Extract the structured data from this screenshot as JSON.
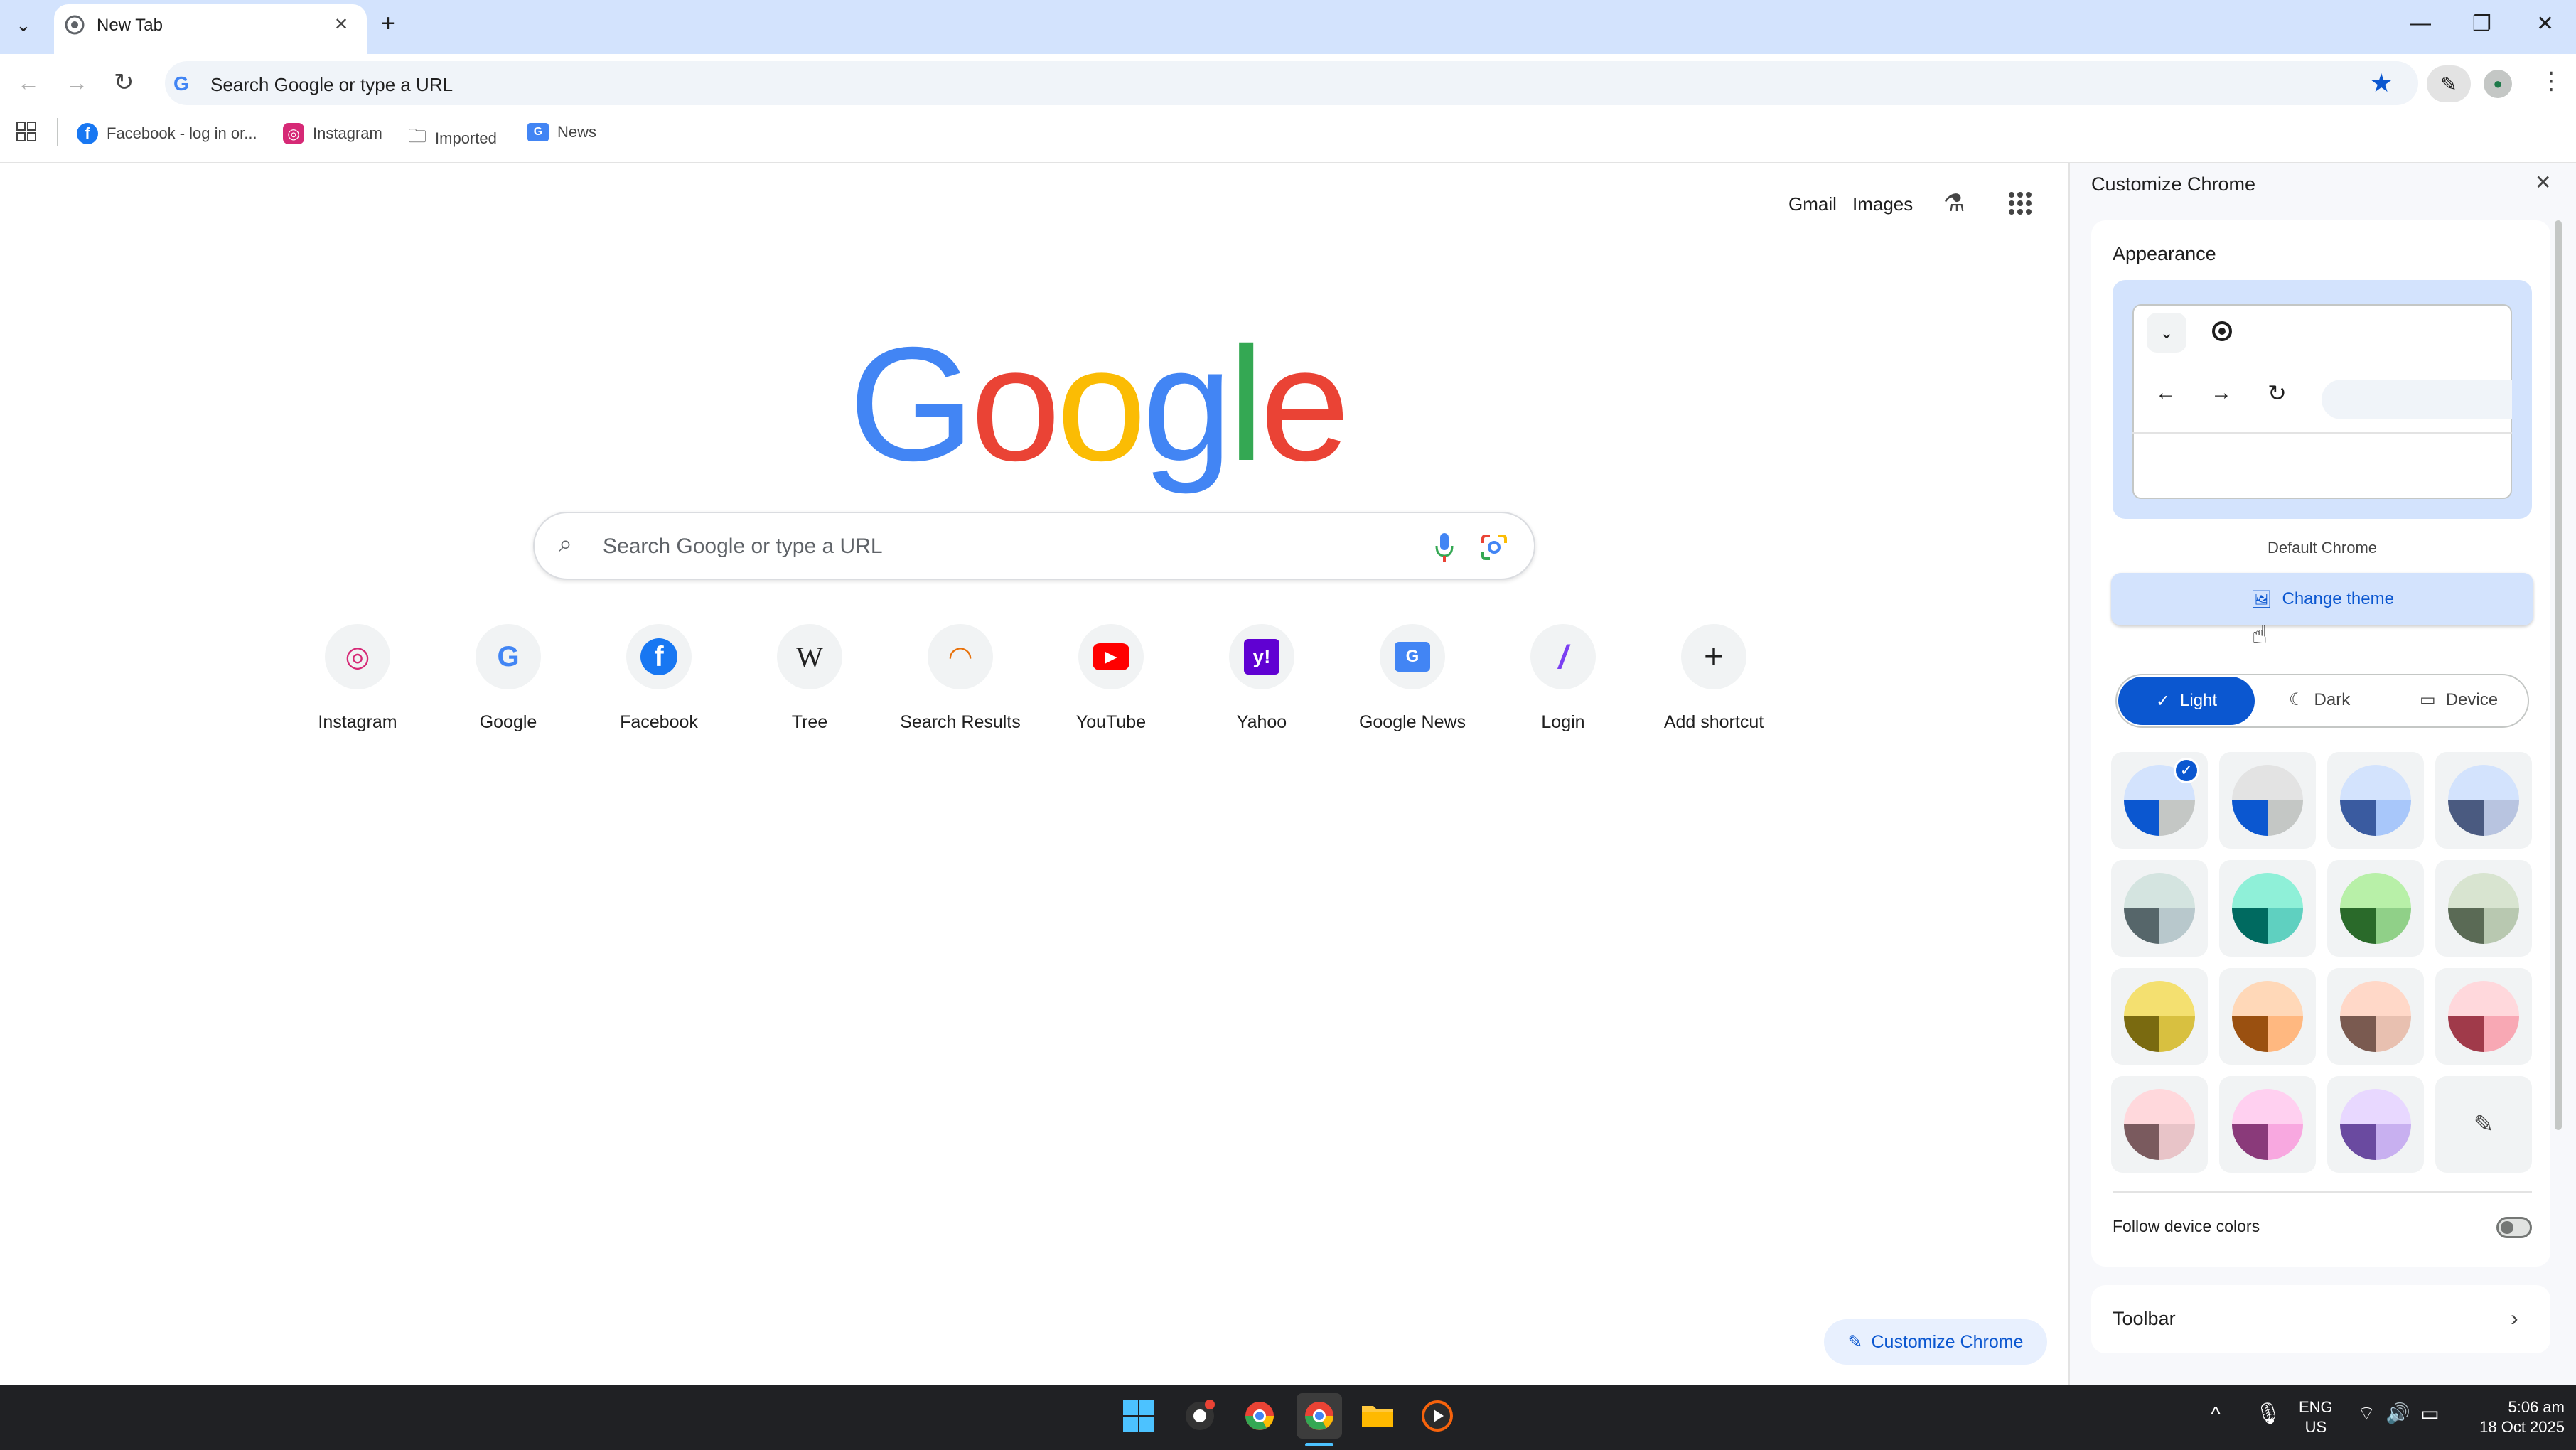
{
  "tab": {
    "title": "New Tab",
    "close": "✕",
    "new": "+"
  },
  "window_controls": {
    "minimize": "—",
    "restore": "❐",
    "close": "✕"
  },
  "omnibox": {
    "text": "Search Google or type a URL"
  },
  "bookmarks": [
    {
      "label": "Facebook - log in or...",
      "icon": "facebook-icon"
    },
    {
      "label": "Instagram",
      "icon": "instagram-icon"
    },
    {
      "label": "Imported",
      "icon": "folder-icon"
    },
    {
      "label": "News",
      "icon": "news-icon"
    }
  ],
  "ntp": {
    "links": {
      "gmail": "Gmail",
      "images": "Images"
    },
    "logo": "Google",
    "search_placeholder": "Search Google or type a URL",
    "shortcuts": [
      {
        "label": "Instagram",
        "glyph": "◎",
        "color": "#d62976"
      },
      {
        "label": "Google",
        "glyph": "G",
        "color": "#4285f4"
      },
      {
        "label": "Facebook",
        "glyph": "f",
        "color": "#1877f2"
      },
      {
        "label": "Tree",
        "glyph": "W",
        "color": "#222222"
      },
      {
        "label": "Search Results",
        "glyph": "◠",
        "color": "#e8710a"
      },
      {
        "label": "YouTube",
        "glyph": "▶",
        "color": "#ff0000"
      },
      {
        "label": "Yahoo",
        "glyph": "y!",
        "color": "#6001d2"
      },
      {
        "label": "Google News",
        "glyph": "G",
        "color": "#4285f4"
      },
      {
        "label": "Login",
        "glyph": "/",
        "color": "#7b3ff2"
      },
      {
        "label": "Add shortcut",
        "glyph": "+",
        "color": "#1f1f1f"
      }
    ],
    "customize_button": "Customize Chrome"
  },
  "panel": {
    "title": "Customize Chrome",
    "appearance": "Appearance",
    "default_label": "Default Chrome",
    "change_theme": "Change theme",
    "modes": {
      "light": "Light",
      "dark": "Dark",
      "device": "Device"
    },
    "swatches": [
      {
        "top": "#d3e3fd",
        "left": "#0b57d0",
        "right": "#c4c7c5",
        "selected": true
      },
      {
        "top": "#e3e3e3",
        "left": "#0b57d0",
        "right": "#c4c7c5"
      },
      {
        "top": "#d3e3fd",
        "left": "#3a5ba0",
        "right": "#a8c7fa"
      },
      {
        "top": "#d3e3fd",
        "left": "#4a5a80",
        "right": "#b8c4e0"
      },
      {
        "top": "#d4e4e0",
        "left": "#56666a",
        "right": "#b8c8cc"
      },
      {
        "top": "#8ff0d8",
        "left": "#006a60",
        "right": "#5fd0c0"
      },
      {
        "top": "#b8f0a8",
        "left": "#2a6a2a",
        "right": "#90d088"
      },
      {
        "top": "#d8e4d0",
        "left": "#5a6a55",
        "right": "#b8c8b0"
      },
      {
        "top": "#f4e070",
        "left": "#7a6a10",
        "right": "#d8c040"
      },
      {
        "top": "#ffd8b8",
        "left": "#9a5010",
        "right": "#ffb880"
      },
      {
        "top": "#ffd8c8",
        "left": "#7a5a50",
        "right": "#e8c0b0"
      },
      {
        "top": "#ffd8dc",
        "left": "#a03a4a",
        "right": "#f8a8b4"
      },
      {
        "top": "#ffd8dc",
        "left": "#7a5a5e",
        "right": "#e8c4c8"
      },
      {
        "top": "#ffd0f0",
        "left": "#8a3a7a",
        "right": "#f8a8e0"
      },
      {
        "top": "#e8d8ff",
        "left": "#6a4aa0",
        "right": "#c8b0f0"
      }
    ],
    "follow_device": "Follow device colors",
    "toolbar": "Toolbar"
  },
  "taskbar": {
    "lang": "ENG",
    "region": "US",
    "time": "5:06 am",
    "date": "18 Oct 2025"
  }
}
